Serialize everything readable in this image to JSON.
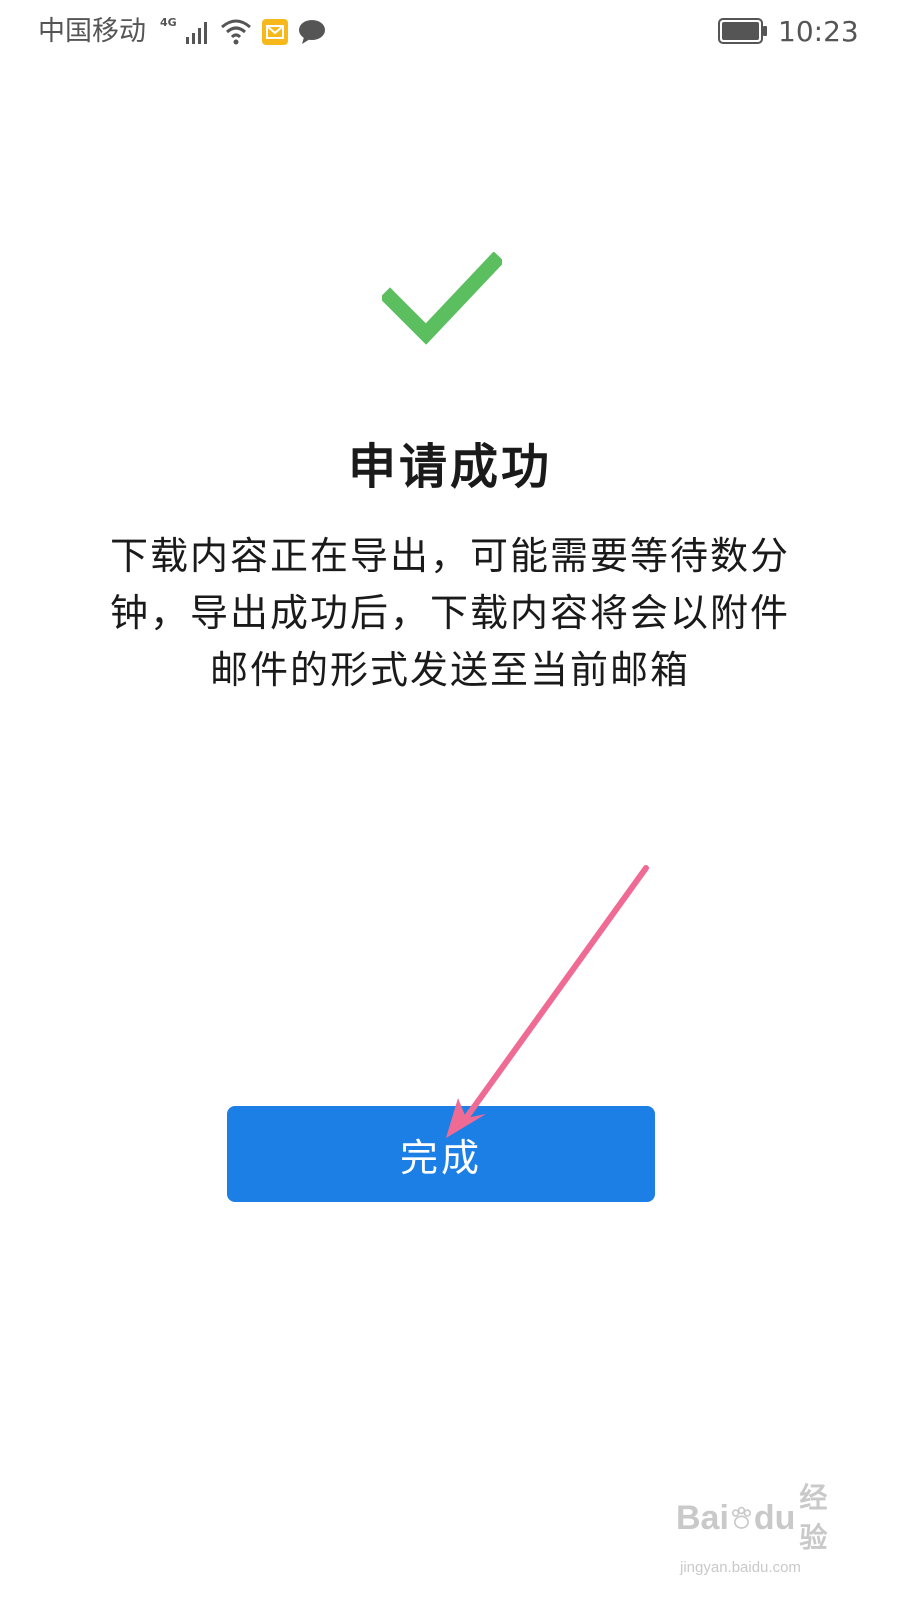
{
  "status_bar": {
    "carrier": "中国移动",
    "network_type": "4G",
    "time": "10:23",
    "icons": [
      "signal-icon",
      "wifi-icon",
      "mail-notification-icon",
      "message-notification-icon",
      "battery-icon"
    ]
  },
  "result": {
    "title": "申请成功",
    "message": "下载内容正在导出，可能需要等待数分钟，导出成功后，下载内容将会以附件邮件的形式发送至当前邮箱",
    "check_color": "#5cbf5f"
  },
  "actions": {
    "done_label": "完成",
    "done_color": "#1c7fe6"
  },
  "annotation": {
    "arrow_color": "#f06b94"
  },
  "watermark": {
    "logo_left": "Bai",
    "logo_right": "du",
    "logo_cn": "经验",
    "url": "jingyan.baidu.com"
  }
}
